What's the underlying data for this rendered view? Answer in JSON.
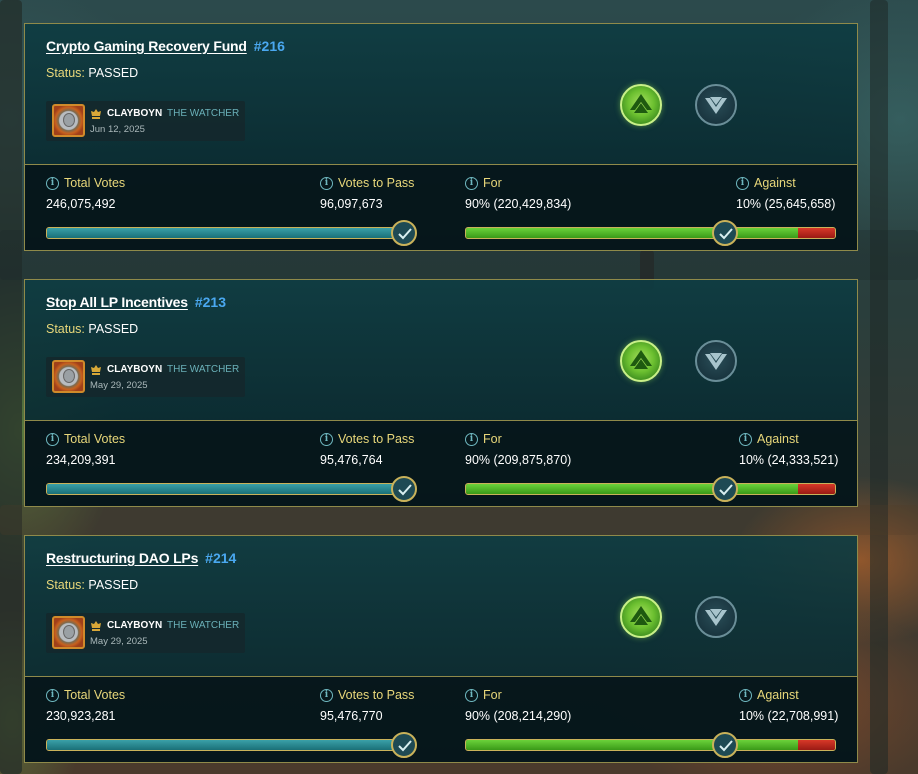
{
  "colors": {
    "accent_gold": "#c9b25a",
    "id_blue": "#4aa8f0",
    "status_label": "#e8d77a",
    "for_green": "#4db02a",
    "against_red": "#c0281a",
    "total_teal": "#2a8a92"
  },
  "labels": {
    "status": "Status:",
    "total_votes": "Total Votes",
    "votes_to_pass": "Votes to Pass",
    "for": "For",
    "against": "Against"
  },
  "proposals": [
    {
      "title": "Crypto Gaming Recovery Fund",
      "id": "#216",
      "status": "PASSED",
      "author": "CLAYBOYN",
      "author_role": "THE WATCHER",
      "date": "Jun 12, 2025",
      "total_votes": "246,075,492",
      "votes_to_pass": "96,097,673",
      "for_text": "90% (220,429,834)",
      "against_text": "10% (25,645,658)",
      "for_percent": 90,
      "against_percent": 10,
      "pass_reached_percent": 100
    },
    {
      "title": "Stop All LP Incentives",
      "id": "#213",
      "status": "PASSED",
      "author": "CLAYBOYN",
      "author_role": "THE WATCHER",
      "date": "May 29, 2025",
      "total_votes": "234,209,391",
      "votes_to_pass": "95,476,764",
      "for_text": "90% (209,875,870)",
      "against_text": "10% (24,333,521)",
      "for_percent": 90,
      "against_percent": 10,
      "pass_reached_percent": 100
    },
    {
      "title": "Restructuring DAO LPs",
      "id": "#214",
      "status": "PASSED",
      "author": "CLAYBOYN",
      "author_role": "THE WATCHER",
      "date": "May 29, 2025",
      "total_votes": "230,923,281",
      "votes_to_pass": "95,476,770",
      "for_text": "90% (208,214,290)",
      "against_text": "10% (22,708,991)",
      "for_percent": 90,
      "against_percent": 10,
      "pass_reached_percent": 100
    }
  ]
}
